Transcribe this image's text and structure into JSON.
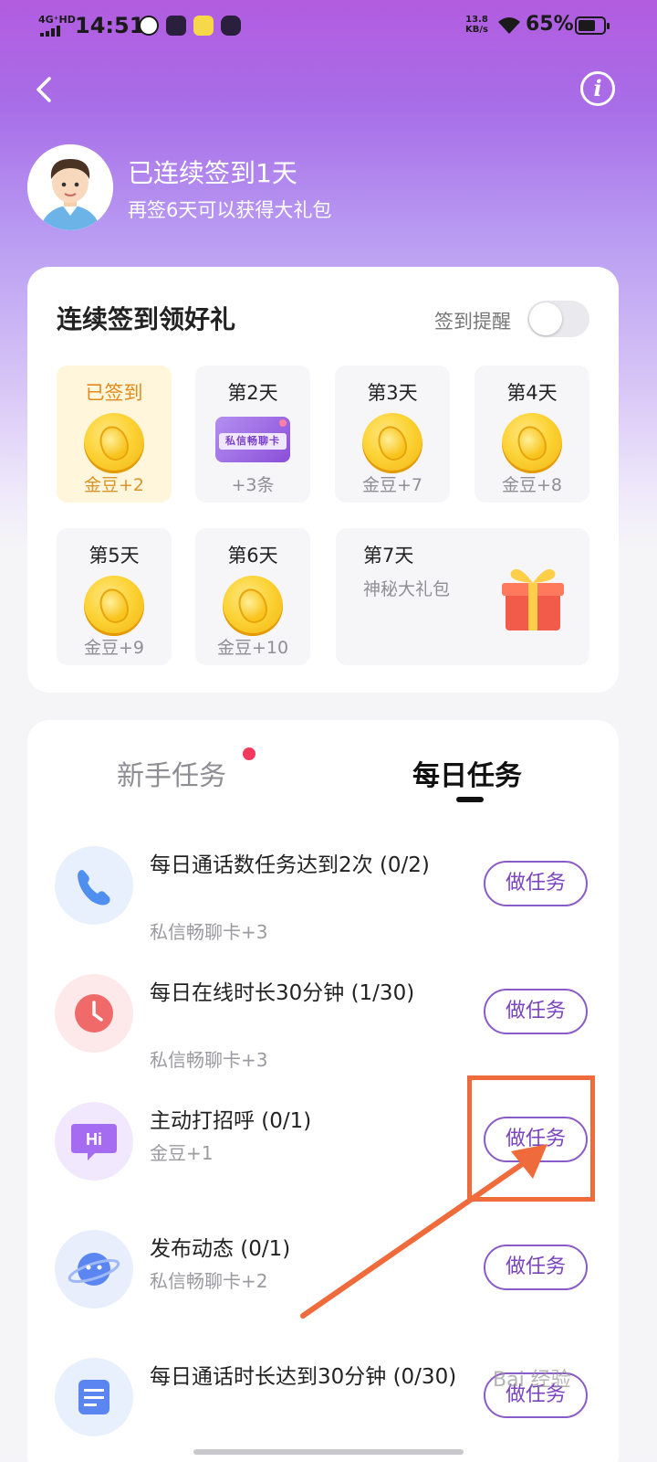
{
  "status_bar": {
    "network": "4G⁺HD",
    "time": "14:51",
    "speed_value": "13.8",
    "speed_unit": "KB/s",
    "battery": "65%"
  },
  "header": {
    "signed_title": "已连续签到1天",
    "signed_sub": "再签6天可以获得大礼包"
  },
  "sign_card": {
    "title": "连续签到领好礼",
    "remind_label": "签到提醒",
    "remind_on": false,
    "days": [
      {
        "label": "已签到",
        "reward": "金豆+2",
        "icon": "coin-icon"
      },
      {
        "label": "第2天",
        "reward": "+3条",
        "icon": "chat-card-icon",
        "card_text": "私信畅聊卡"
      },
      {
        "label": "第3天",
        "reward": "金豆+7",
        "icon": "coin-icon"
      },
      {
        "label": "第4天",
        "reward": "金豆+8",
        "icon": "coin-icon"
      },
      {
        "label": "第5天",
        "reward": "金豆+9",
        "icon": "coin-icon"
      },
      {
        "label": "第6天",
        "reward": "金豆+10",
        "icon": "coin-icon"
      },
      {
        "label": "第7天",
        "reward": "神秘大礼包",
        "icon": "gift-icon"
      }
    ]
  },
  "tasks_card": {
    "tabs": [
      {
        "label": "新手任务",
        "active": false,
        "has_dot": true
      },
      {
        "label": "每日任务",
        "active": true
      }
    ],
    "button_label": "做任务",
    "tasks": [
      {
        "title": "每日通话数任务达到2次 (0/2)",
        "reward": "私信畅聊卡+3",
        "icon": "phone-icon"
      },
      {
        "title": "每日在线时长30分钟 (1/30)",
        "reward": "私信畅聊卡+3",
        "icon": "clock-icon"
      },
      {
        "title": "主动打招呼  (0/1)",
        "reward": "金豆+1",
        "icon": "hi-bubble-icon",
        "icon_text": "Hi"
      },
      {
        "title": "发布动态  (0/1)",
        "reward": "私信畅聊卡+2",
        "icon": "planet-icon"
      },
      {
        "title": "每日通话时长达到30分钟 (0/30)",
        "reward": "",
        "icon": "document-icon"
      }
    ]
  },
  "colors": {
    "accent_purple": "#7a44c0",
    "annotation_orange": "#f06b3c",
    "tab_dot": "#f23a5e"
  },
  "watermark": "Bai 经验"
}
